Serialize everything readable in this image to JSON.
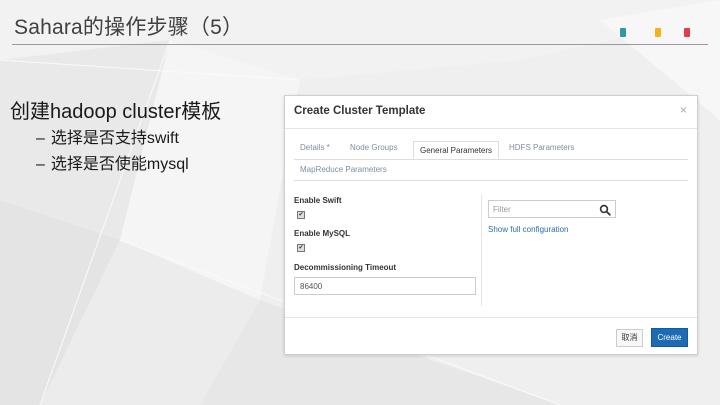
{
  "slide": {
    "title": "Sahara的操作步骤（5）",
    "accent_colors": [
      "#2f98a7",
      "#f2b21b",
      "#e23b4b"
    ]
  },
  "bullets": {
    "main": "创建hadoop cluster模板",
    "dash": "–",
    "sub": [
      "选择是否支持swift",
      "选择是否使能mysql"
    ]
  },
  "modal": {
    "title": "Create Cluster Template",
    "close_symbol": "×",
    "tabs": [
      {
        "label": "Details *",
        "active": false
      },
      {
        "label": "Node Groups",
        "active": false
      },
      {
        "label": "General Parameters",
        "active": true
      },
      {
        "label": "HDFS Parameters",
        "active": false
      },
      {
        "label": "MapReduce Parameters",
        "active": false
      }
    ],
    "fields": {
      "enable_swift_label": "Enable Swift",
      "enable_swift_checked": true,
      "enable_mysql_label": "Enable MySQL",
      "enable_mysql_checked": true,
      "decommissioning_label": "Decommissioning Timeout",
      "decommissioning_value": "86400"
    },
    "filter": {
      "placeholder": "Filter",
      "icon": "search-icon"
    },
    "show_full_link": "Show full configuration",
    "buttons": {
      "cancel": "取消",
      "create": "Create"
    },
    "primary_color": "#1c6bb4"
  }
}
